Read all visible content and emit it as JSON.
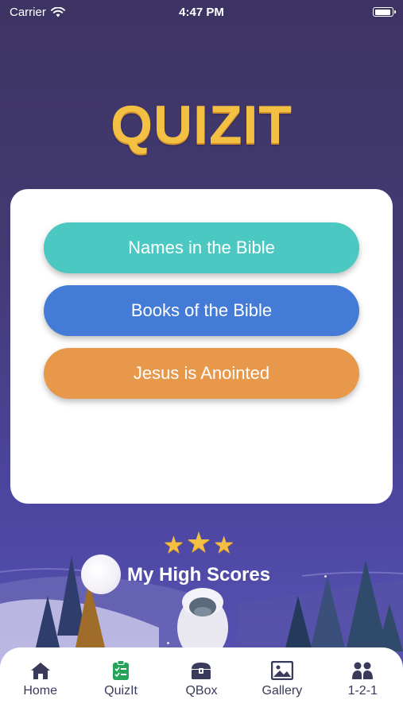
{
  "status_bar": {
    "carrier": "Carrier",
    "time": "4:47 PM"
  },
  "logo": {
    "text": "QUIZIT",
    "color": "#f4c043"
  },
  "quiz_buttons": [
    {
      "label": "Names in the Bible",
      "color": "#4cc8c3"
    },
    {
      "label": "Books of the Bible",
      "color": "#437bd6"
    },
    {
      "label": "Jesus is Anointed",
      "color": "#e7984a"
    }
  ],
  "high_scores": {
    "label": "My High Scores",
    "stars": 3
  },
  "tab_bar": {
    "active": "QuizIt",
    "tabs": [
      {
        "label": "Home",
        "icon": "home-icon"
      },
      {
        "label": "QuizIt",
        "icon": "clipboard-checklist-icon"
      },
      {
        "label": "QBox",
        "icon": "treasure-chest-icon"
      },
      {
        "label": "Gallery",
        "icon": "image-icon"
      },
      {
        "label": "1-2-1",
        "icon": "people-icon"
      }
    ]
  }
}
